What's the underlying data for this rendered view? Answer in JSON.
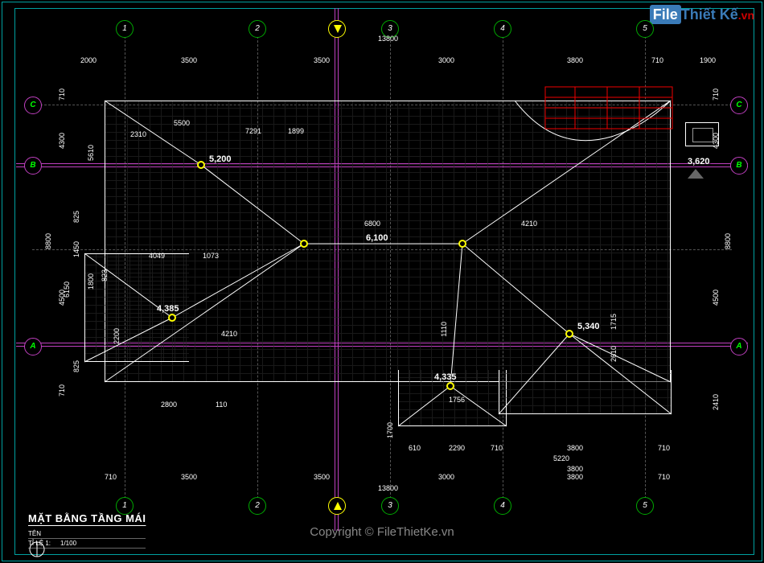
{
  "title": "MẶT BẰNG TẦNG MÁI",
  "scale_label": "TỈ LỆ 1:",
  "scale_value": "1/100",
  "name_label": "TÊN",
  "watermark": "Copyright © FileThietKe.vn",
  "logo": {
    "brand1": "File",
    "brand2": "Thiết Kế",
    "suffix": ".vn"
  },
  "grid_axes": {
    "vertical": [
      "1",
      "2",
      "3",
      "4",
      "5"
    ],
    "horizontal": [
      "A",
      "B",
      "C"
    ]
  },
  "dimensions": {
    "top_row1_total": "13800",
    "top_row1": [
      "2000",
      "3500",
      "3500",
      "3000",
      "3800",
      "710",
      "1900"
    ],
    "top_row2": [
      "5500",
      "7291",
      "1899"
    ],
    "bottom_total": "13800",
    "bottom_row1": [
      "710",
      "3500",
      "3500",
      "3000",
      "3800",
      "710"
    ],
    "bottom_row2": [
      "2800",
      "110",
      "610",
      "2290",
      "710",
      "3800",
      "710"
    ],
    "bottom_row3_right": [
      "5220",
      "3800"
    ],
    "left_total": "8800",
    "left_row1": [
      "710",
      "4300",
      "825",
      "1450",
      "6150",
      "4500",
      "825",
      "710"
    ],
    "left_row2": [
      "5610",
      "1800",
      "2200"
    ],
    "right_total": "8800",
    "right_row1": [
      "710",
      "4300",
      "4500",
      "2410"
    ],
    "right_row2": [
      "1715",
      "2610"
    ],
    "interior": [
      "6800",
      "4210",
      "2310",
      "1756",
      "1110",
      "1700",
      "4049",
      "1073",
      "823",
      "4210"
    ]
  },
  "elevations": {
    "e1": "5,200",
    "e2": "6,100",
    "e3": "4,385",
    "e4": "4,335",
    "e5": "5,340",
    "e6": "3,620"
  }
}
